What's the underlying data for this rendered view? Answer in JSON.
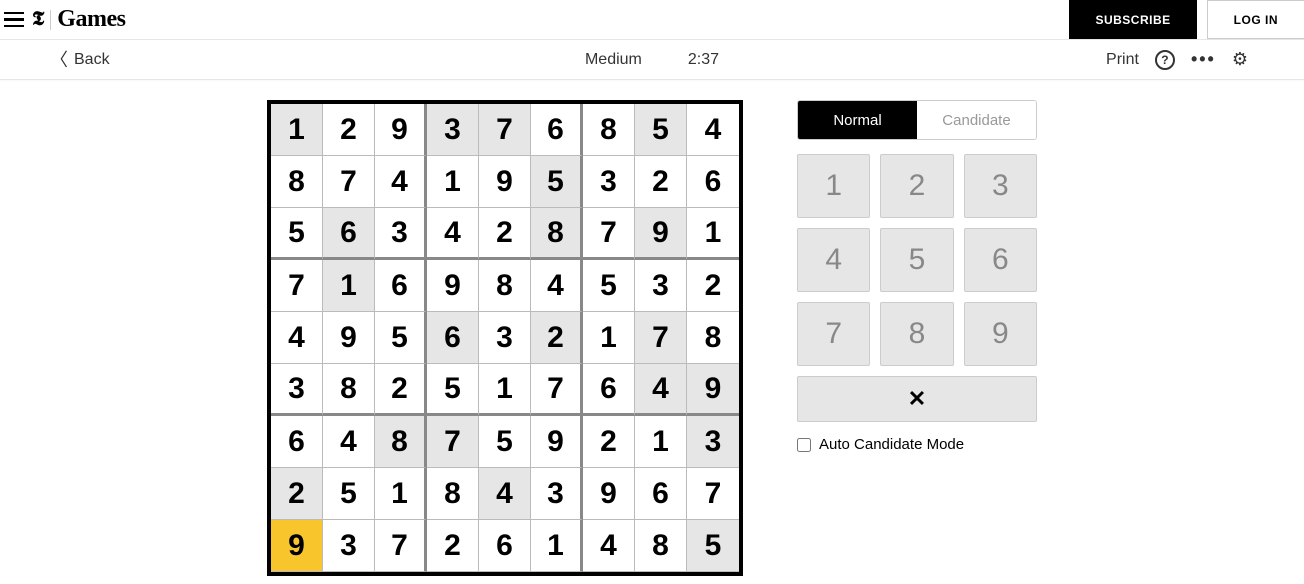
{
  "header": {
    "brand_t": "𝕿",
    "brand_games": "Games",
    "subscribe": "SUBSCRIBE",
    "login": "LOG IN"
  },
  "toolbar": {
    "back": "Back",
    "difficulty": "Medium",
    "timer": "2:37",
    "print": "Print"
  },
  "modes": {
    "normal": "Normal",
    "candidate": "Candidate"
  },
  "keypad": [
    "1",
    "2",
    "3",
    "4",
    "5",
    "6",
    "7",
    "8",
    "9"
  ],
  "erase_glyph": "✕",
  "auto_candidate_label": "Auto Candidate Mode",
  "board": [
    [
      {
        "v": "1",
        "g": true
      },
      {
        "v": "2",
        "g": false
      },
      {
        "v": "9",
        "g": false
      },
      {
        "v": "3",
        "g": true
      },
      {
        "v": "7",
        "g": true
      },
      {
        "v": "6",
        "g": false
      },
      {
        "v": "8",
        "g": false
      },
      {
        "v": "5",
        "g": true
      },
      {
        "v": "4",
        "g": false
      }
    ],
    [
      {
        "v": "8",
        "g": false
      },
      {
        "v": "7",
        "g": false
      },
      {
        "v": "4",
        "g": false
      },
      {
        "v": "1",
        "g": false
      },
      {
        "v": "9",
        "g": false
      },
      {
        "v": "5",
        "g": true
      },
      {
        "v": "3",
        "g": false
      },
      {
        "v": "2",
        "g": false
      },
      {
        "v": "6",
        "g": false
      }
    ],
    [
      {
        "v": "5",
        "g": false
      },
      {
        "v": "6",
        "g": true
      },
      {
        "v": "3",
        "g": false
      },
      {
        "v": "4",
        "g": false
      },
      {
        "v": "2",
        "g": false
      },
      {
        "v": "8",
        "g": true
      },
      {
        "v": "7",
        "g": false
      },
      {
        "v": "9",
        "g": true
      },
      {
        "v": "1",
        "g": false
      }
    ],
    [
      {
        "v": "7",
        "g": false
      },
      {
        "v": "1",
        "g": true
      },
      {
        "v": "6",
        "g": false
      },
      {
        "v": "9",
        "g": false
      },
      {
        "v": "8",
        "g": false
      },
      {
        "v": "4",
        "g": false
      },
      {
        "v": "5",
        "g": false
      },
      {
        "v": "3",
        "g": false
      },
      {
        "v": "2",
        "g": false
      }
    ],
    [
      {
        "v": "4",
        "g": false
      },
      {
        "v": "9",
        "g": false
      },
      {
        "v": "5",
        "g": false
      },
      {
        "v": "6",
        "g": true
      },
      {
        "v": "3",
        "g": false
      },
      {
        "v": "2",
        "g": true
      },
      {
        "v": "1",
        "g": false
      },
      {
        "v": "7",
        "g": true
      },
      {
        "v": "8",
        "g": false
      }
    ],
    [
      {
        "v": "3",
        "g": false
      },
      {
        "v": "8",
        "g": false
      },
      {
        "v": "2",
        "g": false
      },
      {
        "v": "5",
        "g": false
      },
      {
        "v": "1",
        "g": false
      },
      {
        "v": "7",
        "g": false
      },
      {
        "v": "6",
        "g": false
      },
      {
        "v": "4",
        "g": true
      },
      {
        "v": "9",
        "g": true
      }
    ],
    [
      {
        "v": "6",
        "g": false
      },
      {
        "v": "4",
        "g": false
      },
      {
        "v": "8",
        "g": true
      },
      {
        "v": "7",
        "g": true
      },
      {
        "v": "5",
        "g": false
      },
      {
        "v": "9",
        "g": false
      },
      {
        "v": "2",
        "g": false
      },
      {
        "v": "1",
        "g": false
      },
      {
        "v": "3",
        "g": true
      }
    ],
    [
      {
        "v": "2",
        "g": true
      },
      {
        "v": "5",
        "g": false
      },
      {
        "v": "1",
        "g": false
      },
      {
        "v": "8",
        "g": false
      },
      {
        "v": "4",
        "g": true
      },
      {
        "v": "3",
        "g": false
      },
      {
        "v": "9",
        "g": false
      },
      {
        "v": "6",
        "g": false
      },
      {
        "v": "7",
        "g": false
      }
    ],
    [
      {
        "v": "9",
        "g": false,
        "sel": true
      },
      {
        "v": "3",
        "g": false
      },
      {
        "v": "7",
        "g": false
      },
      {
        "v": "2",
        "g": false
      },
      {
        "v": "6",
        "g": false
      },
      {
        "v": "1",
        "g": false
      },
      {
        "v": "4",
        "g": false
      },
      {
        "v": "8",
        "g": false
      },
      {
        "v": "5",
        "g": true
      }
    ]
  ]
}
